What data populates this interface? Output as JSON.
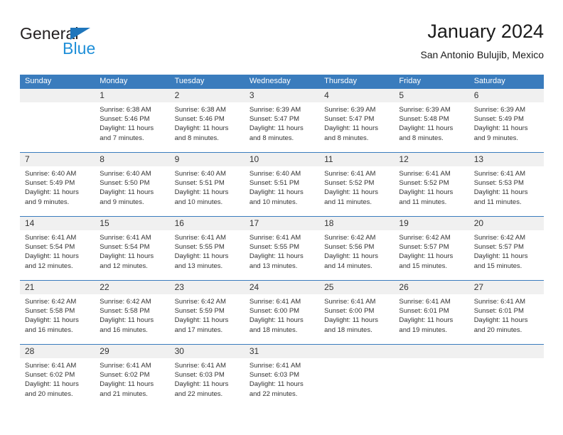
{
  "brand": {
    "name_part1": "General",
    "name_part2": "Blue",
    "triangle_color": "#1f76bc",
    "blue_color": "#1f8fd8"
  },
  "header": {
    "title": "January 2024",
    "subtitle": "San Antonio Bulujib, Mexico"
  },
  "theme": {
    "header_blue": "#3a7cbd",
    "daynum_band": "#f0f0f0",
    "text": "#333333"
  },
  "weekdays": [
    "Sunday",
    "Monday",
    "Tuesday",
    "Wednesday",
    "Thursday",
    "Friday",
    "Saturday"
  ],
  "weeks": [
    [
      {
        "day": "",
        "sunrise": "",
        "sunset": "",
        "daylight_1": "",
        "daylight_2": ""
      },
      {
        "day": "1",
        "sunrise": "Sunrise: 6:38 AM",
        "sunset": "Sunset: 5:46 PM",
        "daylight_1": "Daylight: 11 hours",
        "daylight_2": "and 7 minutes."
      },
      {
        "day": "2",
        "sunrise": "Sunrise: 6:38 AM",
        "sunset": "Sunset: 5:46 PM",
        "daylight_1": "Daylight: 11 hours",
        "daylight_2": "and 8 minutes."
      },
      {
        "day": "3",
        "sunrise": "Sunrise: 6:39 AM",
        "sunset": "Sunset: 5:47 PM",
        "daylight_1": "Daylight: 11 hours",
        "daylight_2": "and 8 minutes."
      },
      {
        "day": "4",
        "sunrise": "Sunrise: 6:39 AM",
        "sunset": "Sunset: 5:47 PM",
        "daylight_1": "Daylight: 11 hours",
        "daylight_2": "and 8 minutes."
      },
      {
        "day": "5",
        "sunrise": "Sunrise: 6:39 AM",
        "sunset": "Sunset: 5:48 PM",
        "daylight_1": "Daylight: 11 hours",
        "daylight_2": "and 8 minutes."
      },
      {
        "day": "6",
        "sunrise": "Sunrise: 6:39 AM",
        "sunset": "Sunset: 5:49 PM",
        "daylight_1": "Daylight: 11 hours",
        "daylight_2": "and 9 minutes."
      }
    ],
    [
      {
        "day": "7",
        "sunrise": "Sunrise: 6:40 AM",
        "sunset": "Sunset: 5:49 PM",
        "daylight_1": "Daylight: 11 hours",
        "daylight_2": "and 9 minutes."
      },
      {
        "day": "8",
        "sunrise": "Sunrise: 6:40 AM",
        "sunset": "Sunset: 5:50 PM",
        "daylight_1": "Daylight: 11 hours",
        "daylight_2": "and 9 minutes."
      },
      {
        "day": "9",
        "sunrise": "Sunrise: 6:40 AM",
        "sunset": "Sunset: 5:51 PM",
        "daylight_1": "Daylight: 11 hours",
        "daylight_2": "and 10 minutes."
      },
      {
        "day": "10",
        "sunrise": "Sunrise: 6:40 AM",
        "sunset": "Sunset: 5:51 PM",
        "daylight_1": "Daylight: 11 hours",
        "daylight_2": "and 10 minutes."
      },
      {
        "day": "11",
        "sunrise": "Sunrise: 6:41 AM",
        "sunset": "Sunset: 5:52 PM",
        "daylight_1": "Daylight: 11 hours",
        "daylight_2": "and 11 minutes."
      },
      {
        "day": "12",
        "sunrise": "Sunrise: 6:41 AM",
        "sunset": "Sunset: 5:52 PM",
        "daylight_1": "Daylight: 11 hours",
        "daylight_2": "and 11 minutes."
      },
      {
        "day": "13",
        "sunrise": "Sunrise: 6:41 AM",
        "sunset": "Sunset: 5:53 PM",
        "daylight_1": "Daylight: 11 hours",
        "daylight_2": "and 11 minutes."
      }
    ],
    [
      {
        "day": "14",
        "sunrise": "Sunrise: 6:41 AM",
        "sunset": "Sunset: 5:54 PM",
        "daylight_1": "Daylight: 11 hours",
        "daylight_2": "and 12 minutes."
      },
      {
        "day": "15",
        "sunrise": "Sunrise: 6:41 AM",
        "sunset": "Sunset: 5:54 PM",
        "daylight_1": "Daylight: 11 hours",
        "daylight_2": "and 12 minutes."
      },
      {
        "day": "16",
        "sunrise": "Sunrise: 6:41 AM",
        "sunset": "Sunset: 5:55 PM",
        "daylight_1": "Daylight: 11 hours",
        "daylight_2": "and 13 minutes."
      },
      {
        "day": "17",
        "sunrise": "Sunrise: 6:41 AM",
        "sunset": "Sunset: 5:55 PM",
        "daylight_1": "Daylight: 11 hours",
        "daylight_2": "and 13 minutes."
      },
      {
        "day": "18",
        "sunrise": "Sunrise: 6:42 AM",
        "sunset": "Sunset: 5:56 PM",
        "daylight_1": "Daylight: 11 hours",
        "daylight_2": "and 14 minutes."
      },
      {
        "day": "19",
        "sunrise": "Sunrise: 6:42 AM",
        "sunset": "Sunset: 5:57 PM",
        "daylight_1": "Daylight: 11 hours",
        "daylight_2": "and 15 minutes."
      },
      {
        "day": "20",
        "sunrise": "Sunrise: 6:42 AM",
        "sunset": "Sunset: 5:57 PM",
        "daylight_1": "Daylight: 11 hours",
        "daylight_2": "and 15 minutes."
      }
    ],
    [
      {
        "day": "21",
        "sunrise": "Sunrise: 6:42 AM",
        "sunset": "Sunset: 5:58 PM",
        "daylight_1": "Daylight: 11 hours",
        "daylight_2": "and 16 minutes."
      },
      {
        "day": "22",
        "sunrise": "Sunrise: 6:42 AM",
        "sunset": "Sunset: 5:58 PM",
        "daylight_1": "Daylight: 11 hours",
        "daylight_2": "and 16 minutes."
      },
      {
        "day": "23",
        "sunrise": "Sunrise: 6:42 AM",
        "sunset": "Sunset: 5:59 PM",
        "daylight_1": "Daylight: 11 hours",
        "daylight_2": "and 17 minutes."
      },
      {
        "day": "24",
        "sunrise": "Sunrise: 6:41 AM",
        "sunset": "Sunset: 6:00 PM",
        "daylight_1": "Daylight: 11 hours",
        "daylight_2": "and 18 minutes."
      },
      {
        "day": "25",
        "sunrise": "Sunrise: 6:41 AM",
        "sunset": "Sunset: 6:00 PM",
        "daylight_1": "Daylight: 11 hours",
        "daylight_2": "and 18 minutes."
      },
      {
        "day": "26",
        "sunrise": "Sunrise: 6:41 AM",
        "sunset": "Sunset: 6:01 PM",
        "daylight_1": "Daylight: 11 hours",
        "daylight_2": "and 19 minutes."
      },
      {
        "day": "27",
        "sunrise": "Sunrise: 6:41 AM",
        "sunset": "Sunset: 6:01 PM",
        "daylight_1": "Daylight: 11 hours",
        "daylight_2": "and 20 minutes."
      }
    ],
    [
      {
        "day": "28",
        "sunrise": "Sunrise: 6:41 AM",
        "sunset": "Sunset: 6:02 PM",
        "daylight_1": "Daylight: 11 hours",
        "daylight_2": "and 20 minutes."
      },
      {
        "day": "29",
        "sunrise": "Sunrise: 6:41 AM",
        "sunset": "Sunset: 6:02 PM",
        "daylight_1": "Daylight: 11 hours",
        "daylight_2": "and 21 minutes."
      },
      {
        "day": "30",
        "sunrise": "Sunrise: 6:41 AM",
        "sunset": "Sunset: 6:03 PM",
        "daylight_1": "Daylight: 11 hours",
        "daylight_2": "and 22 minutes."
      },
      {
        "day": "31",
        "sunrise": "Sunrise: 6:41 AM",
        "sunset": "Sunset: 6:03 PM",
        "daylight_1": "Daylight: 11 hours",
        "daylight_2": "and 22 minutes."
      },
      {
        "day": "",
        "sunrise": "",
        "sunset": "",
        "daylight_1": "",
        "daylight_2": ""
      },
      {
        "day": "",
        "sunrise": "",
        "sunset": "",
        "daylight_1": "",
        "daylight_2": ""
      },
      {
        "day": "",
        "sunrise": "",
        "sunset": "",
        "daylight_1": "",
        "daylight_2": ""
      }
    ]
  ]
}
